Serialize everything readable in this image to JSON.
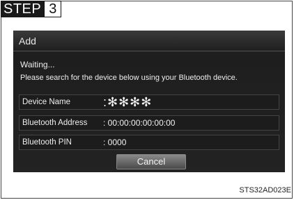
{
  "step": {
    "word": "STEP",
    "number": "3"
  },
  "dialog": {
    "title": "Add",
    "status": "Waiting...",
    "instruction": "Please search for the device below using your Bluetooth device.",
    "fields": [
      {
        "label": "Device Name",
        "value": ":✻✻✻✻"
      },
      {
        "label": "Bluetooth Address",
        "value": ": 00:00:00:00:00:00"
      },
      {
        "label": "Bluetooth PIN",
        "value": ": 0000"
      }
    ],
    "cancel_label": "Cancel"
  },
  "caption": "STS32AD023E"
}
